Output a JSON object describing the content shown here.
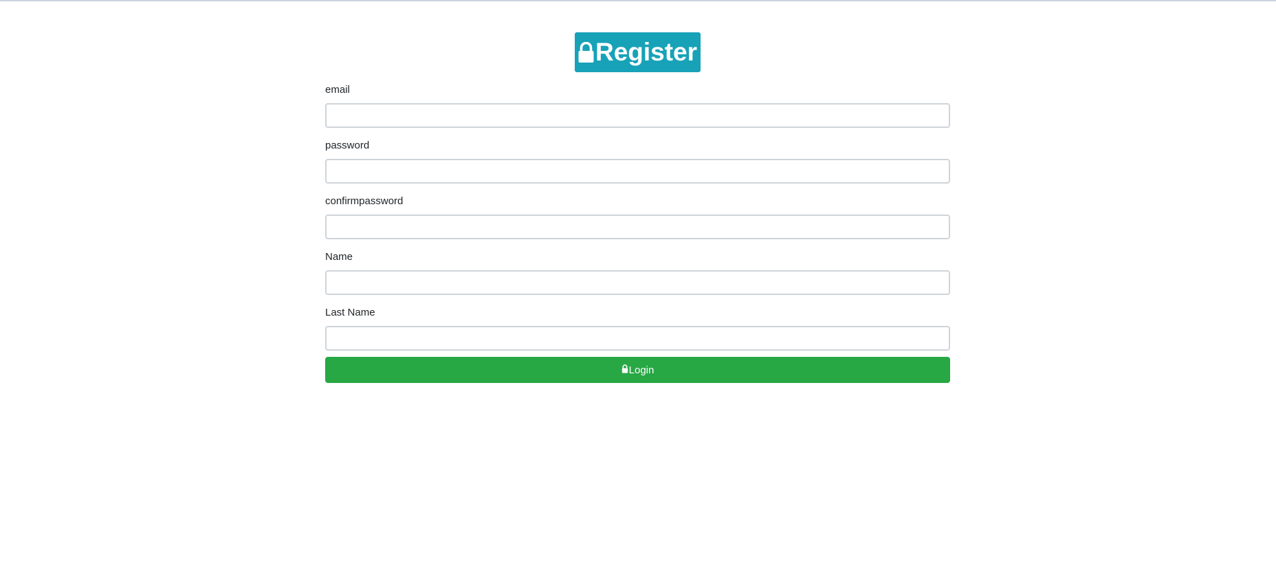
{
  "header": {
    "title": "Register",
    "icon": "lock-icon",
    "badge_color": "#17a2b8"
  },
  "form": {
    "fields": [
      {
        "label": "email",
        "value": "",
        "placeholder": ""
      },
      {
        "label": "password",
        "value": "",
        "placeholder": ""
      },
      {
        "label": "confirmpassword",
        "value": "",
        "placeholder": ""
      },
      {
        "label": "Name",
        "value": "",
        "placeholder": ""
      },
      {
        "label": "Last Name",
        "value": "",
        "placeholder": ""
      }
    ],
    "submit": {
      "label": "Login",
      "icon": "lock-icon",
      "color": "#28a745"
    }
  }
}
